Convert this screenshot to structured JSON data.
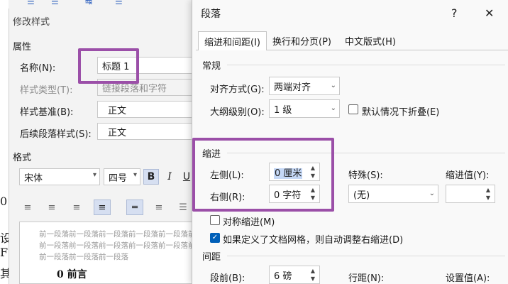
{
  "toolbar_glyphs": [
    "☰",
    "☰",
    "↹",
    "☰"
  ],
  "document": {
    "edge_chars": [
      "0",
      "设",
      "F",
      "其"
    ]
  },
  "style_dialog": {
    "title": "修改样式",
    "properties_heading": "属性",
    "name_label": "名称(N):",
    "name_value": "标题 1",
    "style_type_label": "样式类型(T):",
    "style_type_value": "链接段落和字符",
    "based_on_label": "样式基准(B):",
    "based_on_value": "正文",
    "following_label": "后续段落样式(S):",
    "following_value": "正文",
    "format_heading": "格式",
    "font_value": "宋体",
    "size_value": "四号",
    "bold_label": "B",
    "italic_label": "I",
    "underline_label": "U",
    "preview_lines": [
      "前一段落前一段落前一段落前一段落前一段落前一段落",
      "前一段落前一段落前一段落前一段落前一段落前一段落",
      "前一段落前一段落前一段落"
    ],
    "preview_heading": "0 前言"
  },
  "para_dialog": {
    "title": "段落",
    "help_label": "?",
    "close_label": "✕",
    "tabs": [
      {
        "label": "缩进和间距(I)",
        "active": true
      },
      {
        "label": "换行和分页(P)",
        "active": false
      },
      {
        "label": "中文版式(H)",
        "active": false
      }
    ],
    "general_heading": "常规",
    "alignment_label": "对齐方式(G):",
    "alignment_value": "两端对齐",
    "outline_label": "大纲级别(O):",
    "outline_value": "1 级",
    "collapse_label": "默认情况下折叠(E)",
    "indent_heading": "缩进",
    "left_label": "左侧(L):",
    "left_value": "0 厘米",
    "right_label": "右侧(R):",
    "right_value": "0 字符",
    "special_label": "特殊(S):",
    "special_value": "(无)",
    "indent_by_label": "缩进值(Y):",
    "indent_by_value": "",
    "mirror_label": "对称缩进(M)",
    "mirror_checked": false,
    "auto_adjust_label": "如果定义了文档网格，则自动调整右缩进(D)",
    "auto_adjust_checked": true,
    "spacing_heading": "间距",
    "before_label": "段前(B):",
    "before_value": "6 磅",
    "line_spacing_label": "行距(N):",
    "at_label": "设置值(A):"
  },
  "colors": {
    "highlight": "#9b4fa8",
    "checkbox_accent": "#005fb8"
  }
}
